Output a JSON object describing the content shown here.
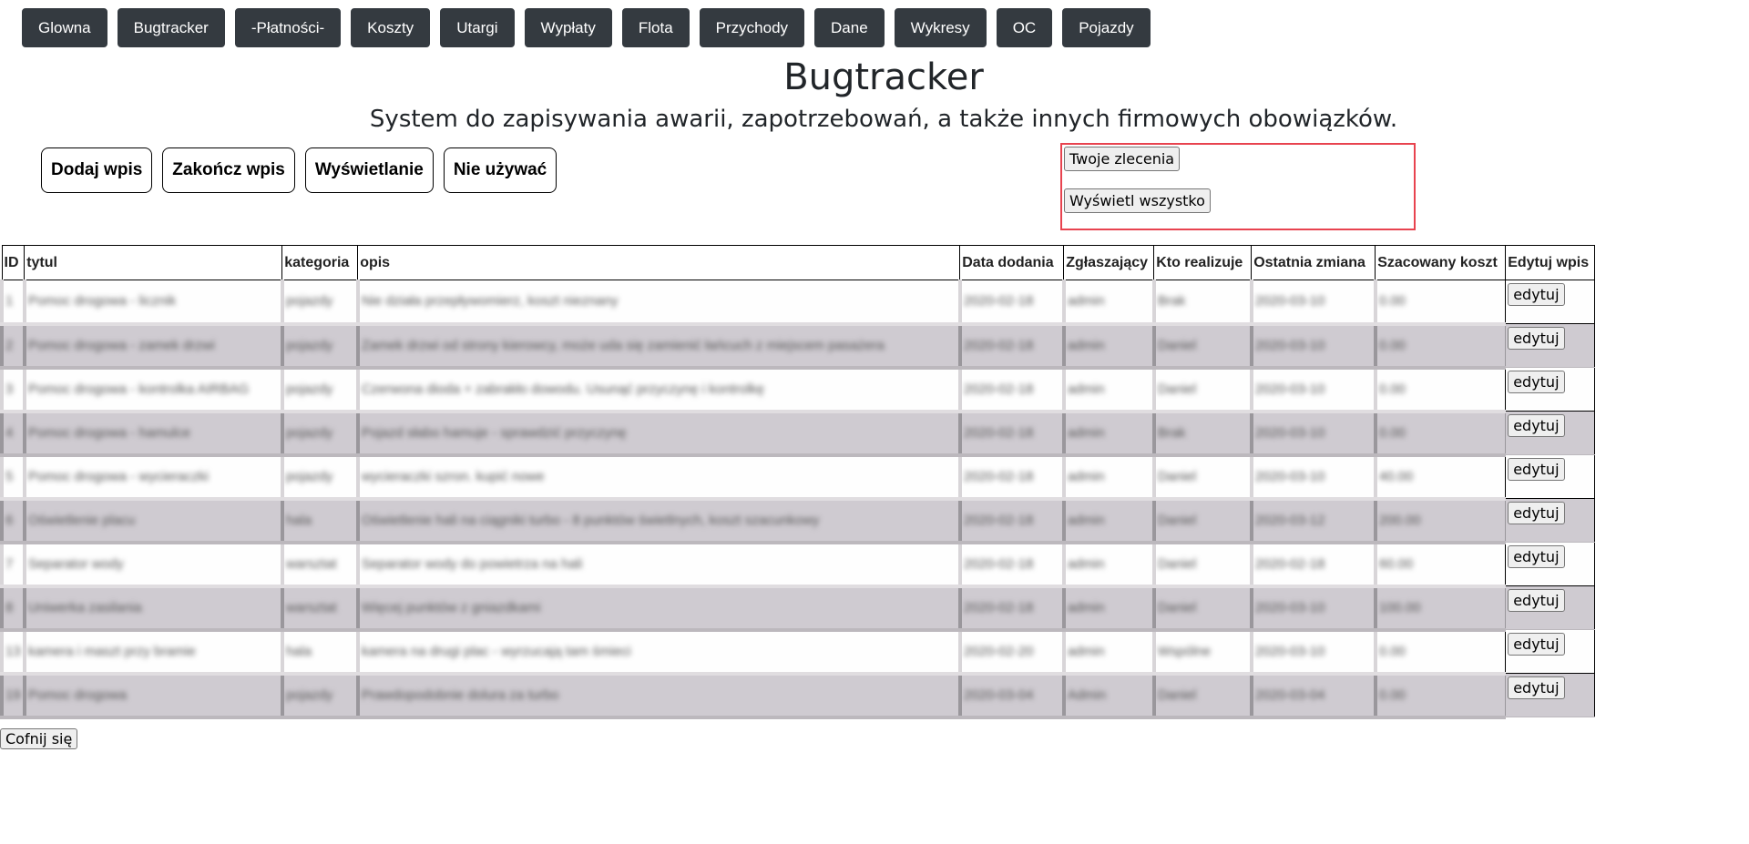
{
  "nav": [
    "Glowna",
    "Bugtracker",
    "-Płatności-",
    "Koszty",
    "Utargi",
    "Wypłaty",
    "Flota",
    "Przychody",
    "Dane",
    "Wykresy",
    "OC",
    "Pojazdy"
  ],
  "page": {
    "title": "Bugtracker",
    "subtitle": "System do zapisywania awarii, zapotrzebowań, a także innych firmowych obowiązków."
  },
  "actions": [
    "Dodaj wpis",
    "Zakończ wpis",
    "Wyświetlanie",
    "Nie używać"
  ],
  "filters": {
    "own": "Twoje zlecenia",
    "all": "Wyświetl wszystko"
  },
  "table": {
    "headers": [
      "ID",
      "tytul",
      "kategoria",
      "opis",
      "Data dodania",
      "Zgłaszający",
      "Kto realizuje",
      "Ostatnia zmiana",
      "Szacowany koszt",
      "Edytuj wpis"
    ],
    "edit_label": "edytuj",
    "rows": [
      [
        "1",
        "Pomoc drogowa - licznik",
        "pojazdy",
        "Nie działa przepływomierz, koszt nieznany",
        "2020-02-18",
        "admin",
        "Brak",
        "2020-03-10",
        "0.00"
      ],
      [
        "2",
        "Pomoc drogowa - zamek drzwi",
        "pojazdy",
        "Zamek drzwi od strony kierowcy, może uda się zamienić łańcuch z miejscem pasażera",
        "2020-02-18",
        "admin",
        "Daniel",
        "2020-03-10",
        "0.00"
      ],
      [
        "3",
        "Pomoc drogowa - kontrolka AIRBAG",
        "pojazdy",
        "Czerwona dioda + zabrakło dowodu. Usunąć przyczynę i kontrolkę",
        "2020-02-18",
        "admin",
        "Daniel",
        "2020-03-10",
        "0.00"
      ],
      [
        "4",
        "Pomoc drogowa - hamulce",
        "pojazdy",
        "Pojazd słabo hamuje - sprawdzić przyczynę",
        "2020-02-18",
        "admin",
        "Brak",
        "2020-03-10",
        "0.00"
      ],
      [
        "5",
        "Pomoc drogowa - wycieraczki",
        "pojazdy",
        "wycieraczki szron. kupić nowe",
        "2020-02-18",
        "admin",
        "Daniel",
        "2020-03-10",
        "40.00"
      ],
      [
        "6",
        "Oświetlenie placu",
        "hala",
        "Oświetlenie hali na ciągniki turbo - 8 punktów świetlnych, koszt szacunkowy",
        "2020-02-18",
        "admin",
        "Daniel",
        "2020-03-12",
        "200.00"
      ],
      [
        "7",
        "Separator wody",
        "warsztat",
        "Separator wody do powietrza na hali",
        "2020-02-18",
        "admin",
        "Daniel",
        "2020-02-18",
        "60.00"
      ],
      [
        "8",
        "Uniwerka zasilania",
        "warsztat",
        "Więcej punktów z gniazdkami",
        "2020-02-18",
        "admin",
        "Daniel",
        "2020-03-10",
        "100.00"
      ],
      [
        "13",
        "kamera i maszt przy bramie",
        "hala",
        "kamera na drugi plac - wyrzucają tam śmieci",
        "2020-02-20",
        "admin",
        "Wspólne",
        "2020-03-10",
        "0.00"
      ],
      [
        "19",
        "Pomoc drogowa",
        "pojazdy",
        "Prawdopodobnie dolura za turbo",
        "2020-03-04",
        "Admin",
        "Daniel",
        "2020-03-04",
        "0.00"
      ]
    ]
  },
  "back_label": "Cofnij się"
}
